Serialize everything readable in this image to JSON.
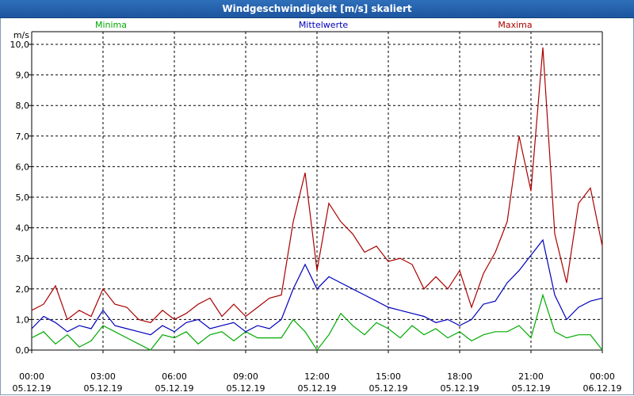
{
  "window": {
    "title": "Windgeschwindigkeit [m/s] skaliert"
  },
  "chart_data": {
    "type": "line",
    "title": "Windgeschwindigkeit [m/s] skaliert",
    "ylabel": "m/s",
    "ylim": [
      0,
      10
    ],
    "xlim": [
      0,
      24
    ],
    "grid": true,
    "legend_placement": "top",
    "y_ticks": [
      "0,0",
      "1,0",
      "2,0",
      "3,0",
      "4,0",
      "5,0",
      "6,0",
      "7,0",
      "8,0",
      "9,0",
      "10,0"
    ],
    "x_ticks": [
      {
        "time": "00:00",
        "date": "05.12.19"
      },
      {
        "time": "03:00",
        "date": "05.12.19"
      },
      {
        "time": "06:00",
        "date": "05.12.19"
      },
      {
        "time": "09:00",
        "date": "05.12.19"
      },
      {
        "time": "12:00",
        "date": "05.12.19"
      },
      {
        "time": "15:00",
        "date": "05.12.19"
      },
      {
        "time": "18:00",
        "date": "05.12.19"
      },
      {
        "time": "21:00",
        "date": "05.12.19"
      },
      {
        "time": "00:00",
        "date": "06.12.19"
      }
    ],
    "series": [
      {
        "name": "Minima",
        "color": "#00aa00",
        "x": [
          0,
          0.5,
          1,
          1.5,
          2,
          2.5,
          3,
          3.5,
          4,
          4.5,
          5,
          5.5,
          6,
          6.5,
          7,
          7.5,
          8,
          8.5,
          9,
          9.5,
          10,
          10.5,
          11,
          11.5,
          12,
          12.5,
          13,
          13.5,
          14,
          14.5,
          15,
          15.5,
          16,
          16.5,
          17,
          17.5,
          18,
          18.5,
          19,
          19.5,
          20,
          20.5,
          21,
          21.5,
          22,
          22.5,
          23,
          23.5,
          24
        ],
        "values": [
          0.4,
          0.6,
          0.2,
          0.5,
          0.1,
          0.3,
          0.8,
          0.6,
          0.4,
          0.2,
          0.0,
          0.5,
          0.4,
          0.6,
          0.2,
          0.5,
          0.6,
          0.3,
          0.6,
          0.4,
          0.4,
          0.4,
          1.0,
          0.6,
          0.0,
          0.5,
          1.2,
          0.8,
          0.5,
          0.9,
          0.7,
          0.4,
          0.8,
          0.5,
          0.7,
          0.4,
          0.6,
          0.3,
          0.5,
          0.6,
          0.6,
          0.8,
          0.4,
          1.8,
          0.6,
          0.4,
          0.5,
          0.5,
          0.0
        ]
      },
      {
        "name": "Mittelwerte",
        "color": "#0000bb",
        "x": [
          0,
          0.5,
          1,
          1.5,
          2,
          2.5,
          3,
          3.5,
          4,
          4.5,
          5,
          5.5,
          6,
          6.5,
          7,
          7.5,
          8,
          8.5,
          9,
          9.5,
          10,
          10.5,
          11,
          11.5,
          12,
          12.5,
          13,
          13.5,
          14,
          14.5,
          15,
          15.5,
          16,
          16.5,
          17,
          17.5,
          18,
          18.5,
          19,
          19.5,
          20,
          20.5,
          21,
          21.5,
          22,
          22.5,
          23,
          23.5,
          24
        ],
        "values": [
          0.7,
          1.1,
          0.9,
          0.6,
          0.8,
          0.7,
          1.3,
          0.8,
          0.7,
          0.6,
          0.5,
          0.8,
          0.6,
          0.9,
          1.0,
          0.7,
          0.8,
          0.9,
          0.6,
          0.8,
          0.7,
          1.0,
          2.0,
          2.8,
          2.0,
          2.4,
          2.2,
          2.0,
          1.8,
          1.6,
          1.4,
          1.3,
          1.2,
          1.1,
          0.9,
          1.0,
          0.8,
          1.0,
          1.5,
          1.6,
          2.2,
          2.6,
          3.1,
          3.6,
          1.8,
          1.0,
          1.4,
          1.6,
          1.7
        ]
      },
      {
        "name": "Maxima",
        "color": "#aa0000",
        "x": [
          0,
          0.5,
          1,
          1.5,
          2,
          2.5,
          3,
          3.5,
          4,
          4.5,
          5,
          5.5,
          6,
          6.5,
          7,
          7.5,
          8,
          8.5,
          9,
          9.5,
          10,
          10.5,
          11,
          11.5,
          12,
          12.5,
          13,
          13.5,
          14,
          14.5,
          15,
          15.5,
          16,
          16.5,
          17,
          17.5,
          18,
          18.5,
          19,
          19.5,
          20,
          20.5,
          21,
          21.5,
          22,
          22.5,
          23,
          23.5,
          24
        ],
        "values": [
          1.3,
          1.5,
          2.1,
          1.0,
          1.3,
          1.1,
          2.0,
          1.5,
          1.4,
          1.0,
          0.9,
          1.3,
          1.0,
          1.2,
          1.5,
          1.7,
          1.1,
          1.5,
          1.1,
          1.4,
          1.7,
          1.8,
          4.2,
          5.8,
          2.6,
          4.8,
          4.2,
          3.8,
          3.2,
          3.4,
          2.9,
          3.0,
          2.8,
          2.0,
          2.4,
          2.0,
          2.6,
          1.4,
          2.5,
          3.2,
          4.2,
          7.0,
          5.2,
          9.9,
          3.8,
          2.2,
          4.8,
          5.3,
          3.4
        ]
      }
    ]
  }
}
